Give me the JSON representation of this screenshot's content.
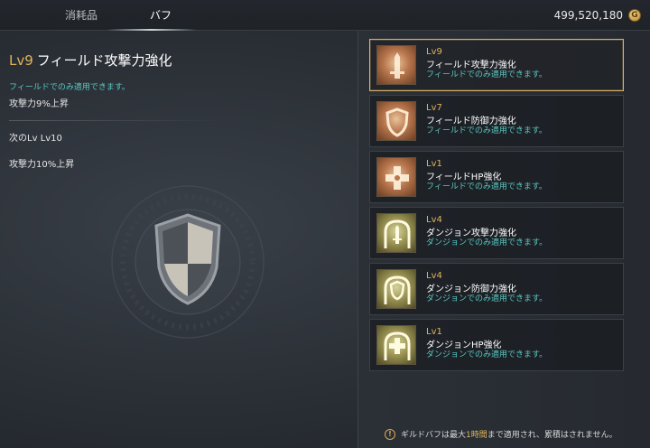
{
  "tabs": [
    {
      "label": "消耗品"
    },
    {
      "label": "バフ"
    }
  ],
  "gold": {
    "amount": "499,520,180",
    "icon": "gold-coin-icon",
    "symbol": "G"
  },
  "detail": {
    "level": "Lv9",
    "title": "フィールド攻撃力強化",
    "condition": "フィールドでのみ適用できます。",
    "effect": "攻撃力9%上昇",
    "next_label": "次のLv",
    "next_level": "Lv10",
    "next_effect": "攻撃力10%上昇",
    "emblem_icon": "shield-emblem-icon"
  },
  "buffs": [
    {
      "level": "Lv9",
      "name": "フィールド攻撃力強化",
      "condition": "フィールドでのみ適用できます。",
      "icon": "sword-icon",
      "selected": true
    },
    {
      "level": "Lv7",
      "name": "フィールド防御力強化",
      "condition": "フィールドでのみ適用できます。",
      "icon": "shield-icon",
      "selected": false
    },
    {
      "level": "Lv1",
      "name": "フィールドHP強化",
      "condition": "フィールドでのみ適用できます。",
      "icon": "cross-icon",
      "selected": false
    },
    {
      "level": "Lv4",
      "name": "ダンジョン攻撃力強化",
      "condition": "ダンジョンでのみ適用できます。",
      "icon": "sword-gate-icon",
      "selected": false
    },
    {
      "level": "Lv4",
      "name": "ダンジョン防御力強化",
      "condition": "ダンジョンでのみ適用できます。",
      "icon": "shield-gate-icon",
      "selected": false
    },
    {
      "level": "Lv1",
      "name": "ダンジョンHP強化",
      "condition": "ダンジョンでのみ適用できます。",
      "icon": "cross-gate-icon",
      "selected": false
    }
  ],
  "footer": {
    "pre": "ギルドバフは最大",
    "highlight": "1時間",
    "post": "まで適用され、累積はされません。",
    "icon": "warning-icon"
  },
  "colors": {
    "accent_gold": "#e0b45c",
    "condition_teal": "#59c8c2",
    "selected_border": "#d8b266"
  }
}
